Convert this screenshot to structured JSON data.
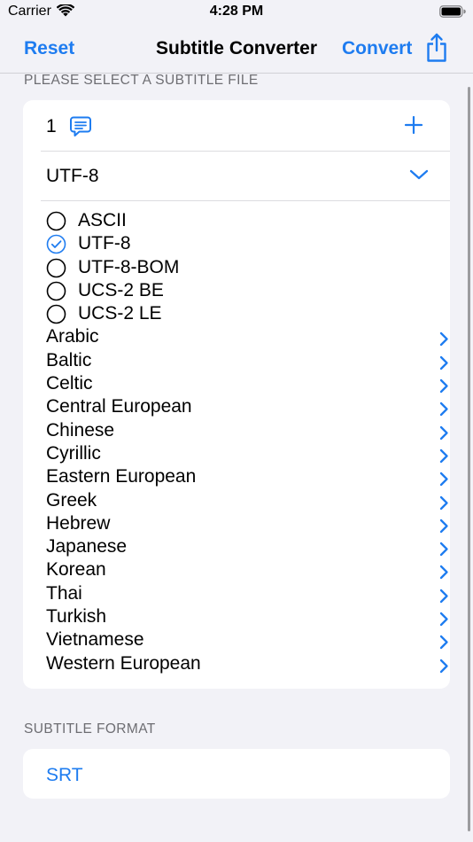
{
  "status_bar": {
    "carrier": "Carrier",
    "time": "4:28 PM"
  },
  "nav": {
    "left_button": "Reset",
    "title": "Subtitle Converter",
    "right_button": "Convert",
    "share_icon": "share-icon"
  },
  "file_section": {
    "header": "PLEASE SELECT A SUBTITLE FILE",
    "file_count": "1",
    "file_icon": "message-icon",
    "add_icon": "plus-icon",
    "encoding": {
      "selected": "UTF-8",
      "unicode_options": [
        {
          "label": "ASCII",
          "checked": false
        },
        {
          "label": "UTF-8",
          "checked": true
        },
        {
          "label": "UTF-8-BOM",
          "checked": false
        },
        {
          "label": "UCS-2 BE",
          "checked": false
        },
        {
          "label": "UCS-2 LE",
          "checked": false
        }
      ],
      "groups": [
        "Arabic",
        "Baltic",
        "Celtic",
        "Central European",
        "Chinese",
        "Cyrillic",
        "Eastern European",
        "Greek",
        "Hebrew",
        "Japanese",
        "Korean",
        "Thai",
        "Turkish",
        "Vietnamese",
        "Western European"
      ]
    }
  },
  "format_section": {
    "header": "SUBTITLE FORMAT",
    "value": "SRT"
  },
  "colors": {
    "accent": "#1e7cf0",
    "background": "#f2f2f7",
    "card": "#ffffff",
    "secondary_text": "#6d6d72"
  }
}
